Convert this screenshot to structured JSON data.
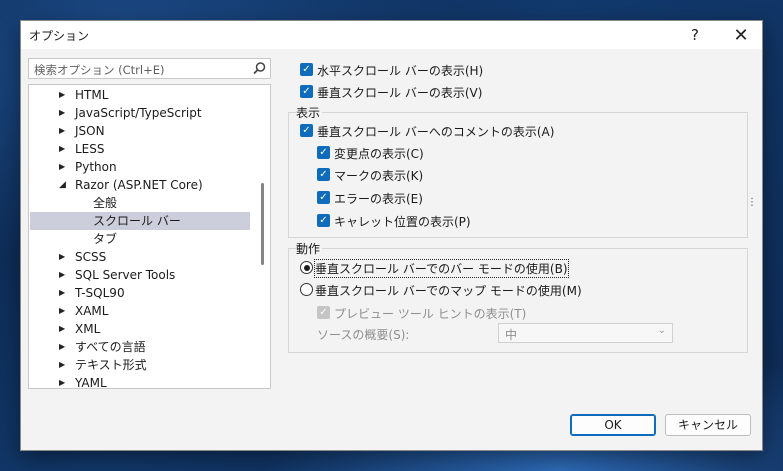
{
  "window": {
    "title": "オプション",
    "help_label": "?",
    "close_label": "✕"
  },
  "search": {
    "placeholder": "検索オプション (Ctrl+E)"
  },
  "tree": {
    "items": [
      {
        "label": "HTML"
      },
      {
        "label": "JavaScript/TypeScript"
      },
      {
        "label": "JSON"
      },
      {
        "label": "LESS"
      },
      {
        "label": "Python"
      },
      {
        "label": "Razor (ASP.NET Core)"
      },
      {
        "label": "全般"
      },
      {
        "label": "スクロール バー"
      },
      {
        "label": "タブ"
      },
      {
        "label": "SCSS"
      },
      {
        "label": "SQL Server Tools"
      },
      {
        "label": "T-SQL90"
      },
      {
        "label": "XAML"
      },
      {
        "label": "XML"
      },
      {
        "label": "すべての言語"
      },
      {
        "label": "テキスト形式"
      },
      {
        "label": "YAML"
      }
    ],
    "selected": "スクロール バー"
  },
  "settings": {
    "show_hscroll": "水平スクロール バーの表示(H)",
    "show_vscroll": "垂直スクロール バーの表示(V)",
    "display_group": {
      "label": "表示",
      "show_annotations": "垂直スクロール バーへのコメントの表示(A)",
      "show_changes": "変更点の表示(C)",
      "show_marks": "マークの表示(K)",
      "show_errors": "エラーの表示(E)",
      "show_caret": "キャレット位置の表示(P)"
    },
    "behavior_group": {
      "label": "動作",
      "bar_mode": "垂直スクロール バーでのバー モードの使用(B)",
      "map_mode": "垂直スクロール バーでのマップ モードの使用(M)",
      "preview_tooltip": "プレビュー ツール ヒントの表示(T)",
      "source_overview_label": "ソースの概要(S):",
      "source_overview_value": "中"
    }
  },
  "buttons": {
    "ok": "OK",
    "cancel": "キャンセル"
  },
  "colors": {
    "accent": "#0f6cbd",
    "selection": "#cccedb"
  }
}
